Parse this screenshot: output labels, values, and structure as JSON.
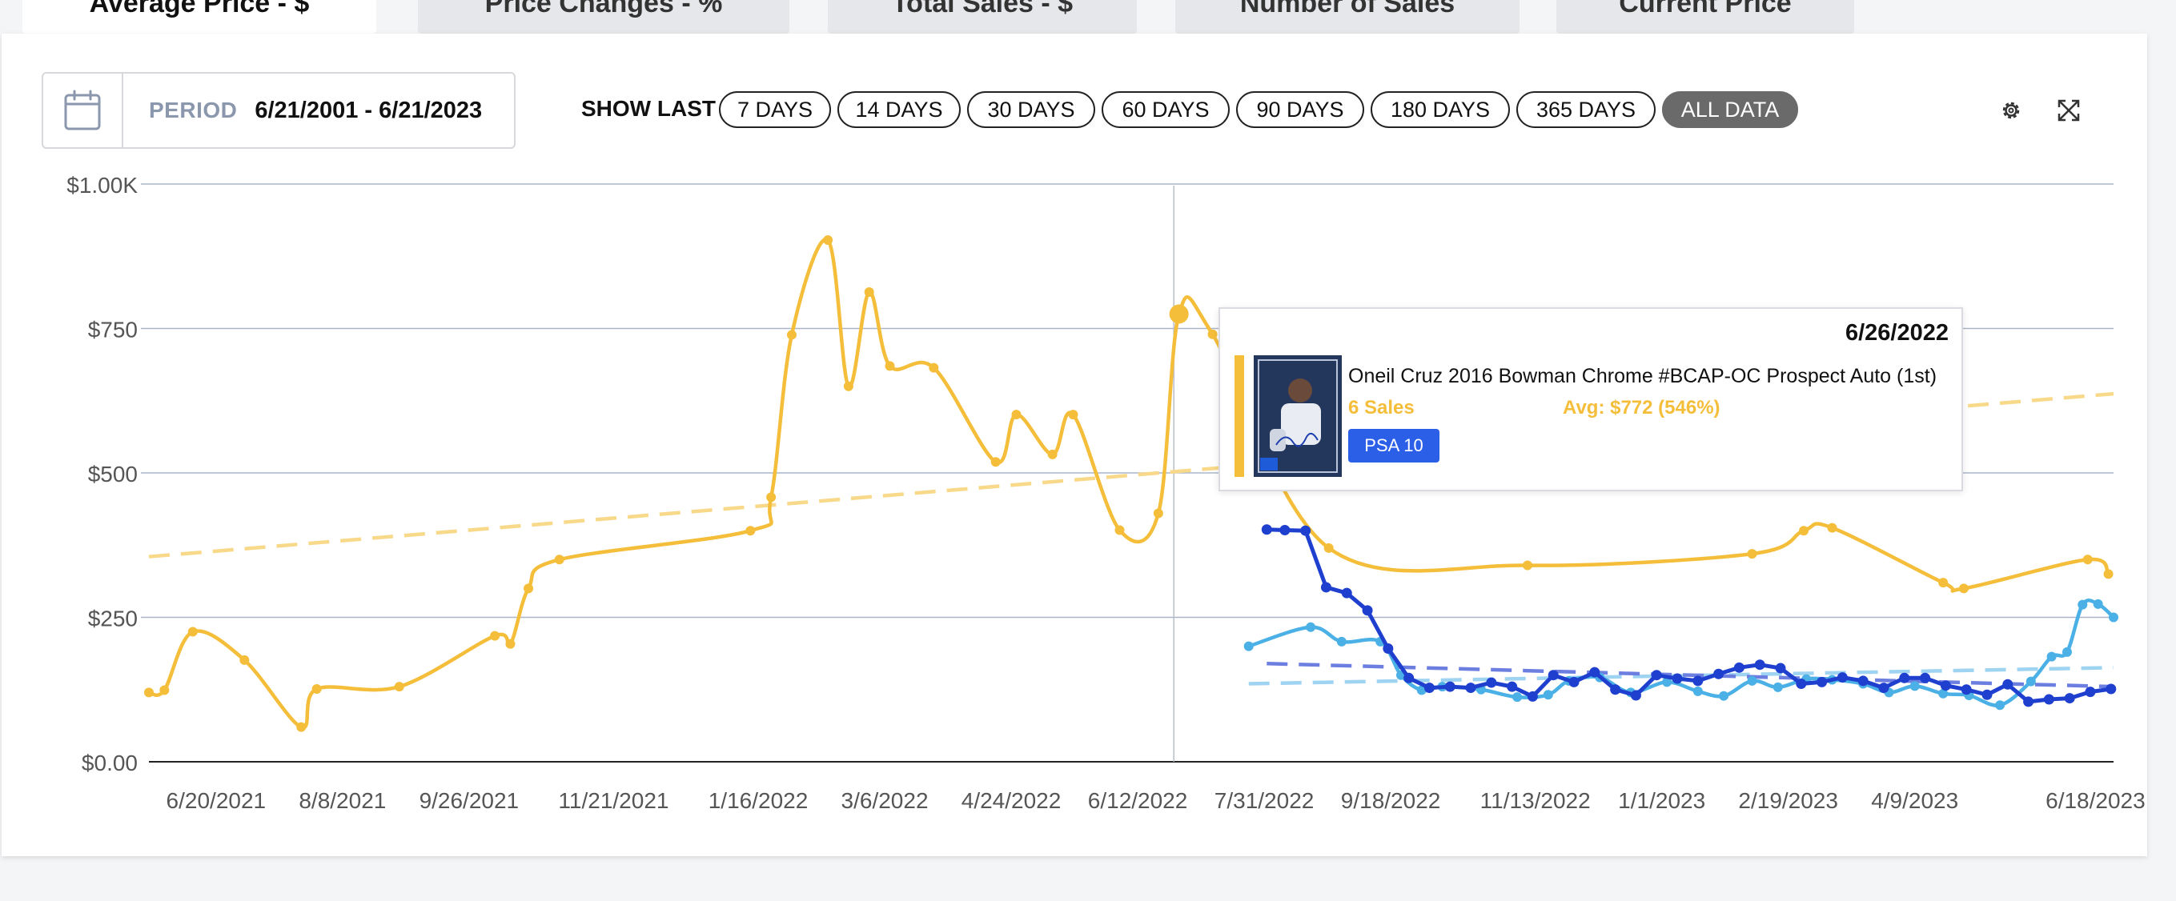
{
  "tabs": [
    {
      "label": "Average Price - $",
      "active": true
    },
    {
      "label": "Price Changes - %",
      "active": false
    },
    {
      "label": "Total Sales - $",
      "active": false
    },
    {
      "label": "Number of Sales",
      "active": false
    },
    {
      "label": "Current Price",
      "active": false
    }
  ],
  "period": {
    "label": "PERIOD",
    "value": "6/21/2001 - 6/21/2023",
    "icon": "calendar-icon"
  },
  "show_last": {
    "label": "SHOW LAST",
    "options": [
      "7 DAYS",
      "14 DAYS",
      "30 DAYS",
      "60 DAYS",
      "90 DAYS",
      "180 DAYS",
      "365 DAYS",
      "ALL DATA"
    ],
    "selected": "ALL DATA"
  },
  "toolbar": {
    "settings_icon": "gear-icon",
    "expand_icon": "expand-icon"
  },
  "colors": {
    "gold": "#f4be3a",
    "gold_trend": "#f8d98a",
    "light_blue": "#4ab0e6",
    "dark_blue": "#1f3fcf",
    "accent": "#2b5fe8"
  },
  "tooltip": {
    "date": "6/26/2022",
    "title": "Oneil Cruz 2016 Bowman Chrome #BCAP-OC Prospect Auto (1st)",
    "sales": "6 Sales",
    "avg": "Avg: $772 (546%)",
    "grade": "PSA 10"
  },
  "chart_data": {
    "type": "line",
    "y_ticks": [
      "$0.00",
      "$250",
      "$500",
      "$750",
      "$1.00K"
    ],
    "y_range": [
      0,
      1000
    ],
    "x_range": [
      "2021-05-25",
      "2023-06-25"
    ],
    "x_ticks": [
      {
        "date": "2021-06-20",
        "label": "6/20/2021"
      },
      {
        "date": "2021-08-08",
        "label": "8/8/2021"
      },
      {
        "date": "2021-09-26",
        "label": "9/26/2021"
      },
      {
        "date": "2021-11-21",
        "label": "11/21/2021"
      },
      {
        "date": "2022-01-16",
        "label": "1/16/2022"
      },
      {
        "date": "2022-03-06",
        "label": "3/6/2022"
      },
      {
        "date": "2022-04-24",
        "label": "4/24/2022"
      },
      {
        "date": "2022-06-12",
        "label": "6/12/2022"
      },
      {
        "date": "2022-07-31",
        "label": "7/31/2022"
      },
      {
        "date": "2022-09-18",
        "label": "9/18/2022"
      },
      {
        "date": "2022-11-13",
        "label": "11/13/2022"
      },
      {
        "date": "2023-01-01",
        "label": "1/1/2023"
      },
      {
        "date": "2023-02-19",
        "label": "2/19/2023"
      },
      {
        "date": "2023-04-09",
        "label": "4/9/2023"
      },
      {
        "date": "2023-06-18",
        "label": "6/18/2023"
      }
    ],
    "grid": true,
    "crosshair_date": "2022-06-26",
    "series": [
      {
        "color": "#f4be3a",
        "points": [
          [
            "2021-05-25",
            120
          ],
          [
            "2021-05-31",
            124
          ],
          [
            "2021-06-11",
            225
          ],
          [
            "2021-07-01",
            176
          ],
          [
            "2021-07-23",
            60
          ],
          [
            "2021-07-29",
            126
          ],
          [
            "2021-08-30",
            130
          ],
          [
            "2021-10-06",
            218
          ],
          [
            "2021-10-12",
            204
          ],
          [
            "2021-10-19",
            300
          ],
          [
            "2021-10-31",
            350
          ],
          [
            "2022-01-13",
            400
          ],
          [
            "2022-01-21",
            458
          ],
          [
            "2022-01-29",
            739
          ],
          [
            "2022-02-12",
            903
          ],
          [
            "2022-02-20",
            650
          ],
          [
            "2022-02-28",
            813
          ],
          [
            "2022-03-08",
            685
          ],
          [
            "2022-03-25",
            682
          ],
          [
            "2022-04-18",
            519
          ],
          [
            "2022-04-26",
            601
          ],
          [
            "2022-05-10",
            532
          ],
          [
            "2022-05-18",
            601
          ],
          [
            "2022-06-05",
            401
          ],
          [
            "2022-06-20",
            430
          ],
          [
            "2022-06-28",
            775
          ],
          [
            "2022-07-11",
            740
          ],
          [
            "2022-08-25",
            370
          ],
          [
            "2022-11-10",
            340
          ],
          [
            "2023-02-05",
            360
          ],
          [
            "2023-02-25",
            400
          ],
          [
            "2023-03-08",
            405
          ],
          [
            "2023-04-20",
            310
          ],
          [
            "2023-04-28",
            300
          ],
          [
            "2023-06-15",
            350
          ],
          [
            "2023-06-23",
            325
          ]
        ]
      },
      {
        "color": "#4ab0e6",
        "points": [
          [
            "2022-07-25",
            200
          ],
          [
            "2022-08-18",
            233
          ],
          [
            "2022-08-30",
            208
          ],
          [
            "2022-09-14",
            208
          ],
          [
            "2022-09-22",
            150
          ],
          [
            "2022-09-30",
            124
          ],
          [
            "2022-10-08",
            130
          ],
          [
            "2022-10-23",
            125
          ],
          [
            "2022-11-06",
            112
          ],
          [
            "2022-11-18",
            116
          ],
          [
            "2022-11-26",
            140
          ],
          [
            "2022-12-08",
            146
          ],
          [
            "2022-12-20",
            120
          ],
          [
            "2023-01-03",
            138
          ],
          [
            "2023-01-15",
            122
          ],
          [
            "2023-01-25",
            114
          ],
          [
            "2023-02-05",
            140
          ],
          [
            "2023-02-15",
            129
          ],
          [
            "2023-02-26",
            143
          ],
          [
            "2023-03-08",
            142
          ],
          [
            "2023-03-20",
            135
          ],
          [
            "2023-03-30",
            120
          ],
          [
            "2023-04-09",
            131
          ],
          [
            "2023-04-20",
            118
          ],
          [
            "2023-04-30",
            115
          ],
          [
            "2023-05-12",
            98
          ],
          [
            "2023-05-24",
            139
          ],
          [
            "2023-06-01",
            182
          ],
          [
            "2023-06-07",
            190
          ],
          [
            "2023-06-13",
            272
          ],
          [
            "2023-06-19",
            273
          ],
          [
            "2023-06-25",
            250
          ]
        ]
      },
      {
        "color": "#1f3fcf",
        "points": [
          [
            "2022-08-01",
            402
          ],
          [
            "2022-08-08",
            401
          ],
          [
            "2022-08-16",
            400
          ],
          [
            "2022-08-24",
            302
          ],
          [
            "2022-09-01",
            292
          ],
          [
            "2022-09-09",
            262
          ],
          [
            "2022-09-17",
            196
          ],
          [
            "2022-09-25",
            145
          ],
          [
            "2022-10-03",
            128
          ],
          [
            "2022-10-11",
            130
          ],
          [
            "2022-10-19",
            128
          ],
          [
            "2022-10-27",
            137
          ],
          [
            "2022-11-04",
            130
          ],
          [
            "2022-11-12",
            113
          ],
          [
            "2022-11-20",
            150
          ],
          [
            "2022-11-28",
            138
          ],
          [
            "2022-12-06",
            155
          ],
          [
            "2022-12-14",
            125
          ],
          [
            "2022-12-22",
            115
          ],
          [
            "2022-12-30",
            150
          ],
          [
            "2023-01-07",
            144
          ],
          [
            "2023-01-15",
            140
          ],
          [
            "2023-01-23",
            152
          ],
          [
            "2023-01-31",
            163
          ],
          [
            "2023-02-08",
            168
          ],
          [
            "2023-02-16",
            162
          ],
          [
            "2023-02-24",
            135
          ],
          [
            "2023-03-04",
            138
          ],
          [
            "2023-03-12",
            146
          ],
          [
            "2023-03-20",
            140
          ],
          [
            "2023-03-28",
            128
          ],
          [
            "2023-04-05",
            145
          ],
          [
            "2023-04-13",
            145
          ],
          [
            "2023-04-21",
            132
          ],
          [
            "2023-04-29",
            125
          ],
          [
            "2023-05-07",
            116
          ],
          [
            "2023-05-15",
            134
          ],
          [
            "2023-05-23",
            104
          ],
          [
            "2023-05-31",
            108
          ],
          [
            "2023-06-08",
            110
          ],
          [
            "2023-06-16",
            121
          ],
          [
            "2023-06-24",
            126
          ]
        ]
      }
    ],
    "trendlines": [
      {
        "color": "#f8d98a",
        "from": [
          "2021-05-25",
          355
        ],
        "to": [
          "2023-06-25",
          637
        ]
      },
      {
        "color": "#9fd3f2",
        "from": [
          "2022-07-25",
          135
        ],
        "to": [
          "2023-06-25",
          163
        ]
      },
      {
        "color": "#6c7fe0",
        "from": [
          "2022-08-01",
          170
        ],
        "to": [
          "2023-06-25",
          130
        ]
      }
    ]
  }
}
